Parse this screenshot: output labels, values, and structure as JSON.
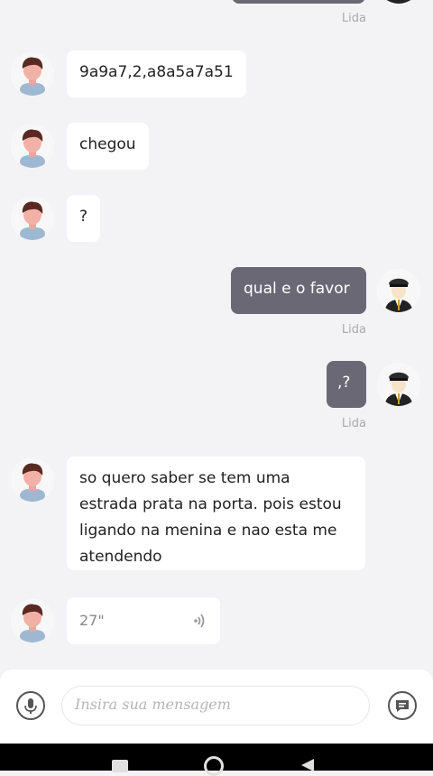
{
  "messages": [
    {
      "side": "in",
      "text": "9a9a7,2,a8a5a7a51"
    },
    {
      "side": "in",
      "text": "chegou"
    },
    {
      "side": "in",
      "text": "?"
    },
    {
      "side": "out",
      "text": "qual e o favor",
      "status": "Lida"
    },
    {
      "side": "out",
      "text": ",?",
      "status": "Lida"
    },
    {
      "side": "in",
      "text": "so quero saber se tem uma estrada prata na porta. pois estou ligando na menina e nao esta me atendendo"
    },
    {
      "side": "in",
      "type": "audio",
      "duration": "27\""
    }
  ],
  "top_status": "Lida",
  "composer": {
    "placeholder": "Insira sua mensagem",
    "mic_icon": "microphone-icon",
    "send_icon": "message-icon"
  },
  "colors": {
    "background": "#f3f3f5",
    "outgoing_bubble": "#6b6876",
    "incoming_bubble": "#ffffff",
    "status_text": "#aaaaaa"
  }
}
